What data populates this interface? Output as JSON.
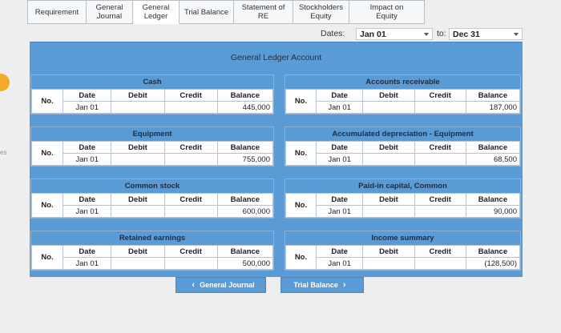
{
  "tabs": [
    {
      "label": "Requirement",
      "active": false
    },
    {
      "label": "General\nJournal",
      "active": false
    },
    {
      "label": "General\nLedger",
      "active": true
    },
    {
      "label": "Trial Balance",
      "active": false
    },
    {
      "label": "Statement of\nRE",
      "active": false
    },
    {
      "label": "Stockholders\nEquity",
      "active": false
    },
    {
      "label": "Impact on\nEquity",
      "active": false
    }
  ],
  "dates": {
    "label": "Dates:",
    "from": "Jan 01",
    "to_label": "to:",
    "to": "Dec 31"
  },
  "header": {
    "title": "General Ledger Account"
  },
  "columns": {
    "no": "No.",
    "date": "Date",
    "debit": "Debit",
    "credit": "Credit",
    "balance": "Balance"
  },
  "accounts": [
    {
      "title": "Cash",
      "date": "Jan 01",
      "balance": "445,000"
    },
    {
      "title": "Accounts receivable",
      "date": "Jan 01",
      "balance": "187,000"
    },
    {
      "title": "Equipment",
      "date": "Jan 01",
      "balance": "755,000"
    },
    {
      "title": "Accumulated depreciation - Equipment",
      "date": "Jan 01",
      "balance": "68,500"
    },
    {
      "title": "Common stock",
      "date": "Jan 01",
      "balance": "600,000"
    },
    {
      "title": "Paid-in capital, Common",
      "date": "Jan 01",
      "balance": "90,000"
    },
    {
      "title": "Retained earnings",
      "date": "Jan 01",
      "balance": "500,000"
    },
    {
      "title": "Income summary",
      "date": "Jan 01",
      "balance": "(128,500)"
    }
  ],
  "nav": {
    "prev": "General Journal",
    "next": "Trial Balance"
  },
  "edge_text": "es",
  "colors": {
    "accent": "#5b9bd5",
    "notification": "#f4a92a"
  }
}
